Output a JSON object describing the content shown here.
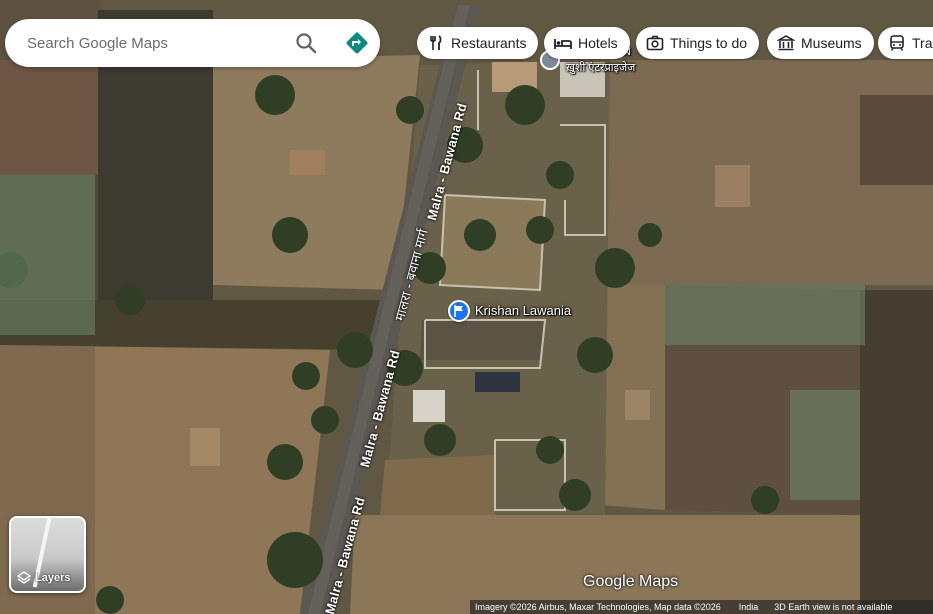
{
  "search": {
    "placeholder": "Search Google Maps",
    "search_icon": "search-icon",
    "directions_icon": "directions-icon"
  },
  "chips": [
    {
      "label": "Restaurants",
      "icon": "fork-knife-icon"
    },
    {
      "label": "Hotels",
      "icon": "bed-icon"
    },
    {
      "label": "Things to do",
      "icon": "camera-icon"
    },
    {
      "label": "Museums",
      "icon": "museum-icon"
    },
    {
      "label": "Tran",
      "icon": "transit-icon"
    }
  ],
  "places": {
    "main_place": "Krishan Lawania",
    "top_place_hindi": "ख़ुशी एंटरप्राइजेज",
    "top_place_partial": "N"
  },
  "roads": {
    "upper_label": "Malra - Bawana Rd",
    "upper_hindi": "मालरा - बवाना मार्ग",
    "lower_label": "Malra - Bawana Rd",
    "lower_label_2": "Malra - Bawana Rd"
  },
  "layers": {
    "label": "Layers"
  },
  "watermark": "Google Maps",
  "attribution": {
    "imagery": "Imagery ©2026 Airbus, Maxar Technologies, Map data ©2026",
    "region": "India",
    "notice": "3D Earth view is not available"
  },
  "colors": {
    "accent_blue": "#1a73e8",
    "directions_teal": "#0b8a7f"
  }
}
